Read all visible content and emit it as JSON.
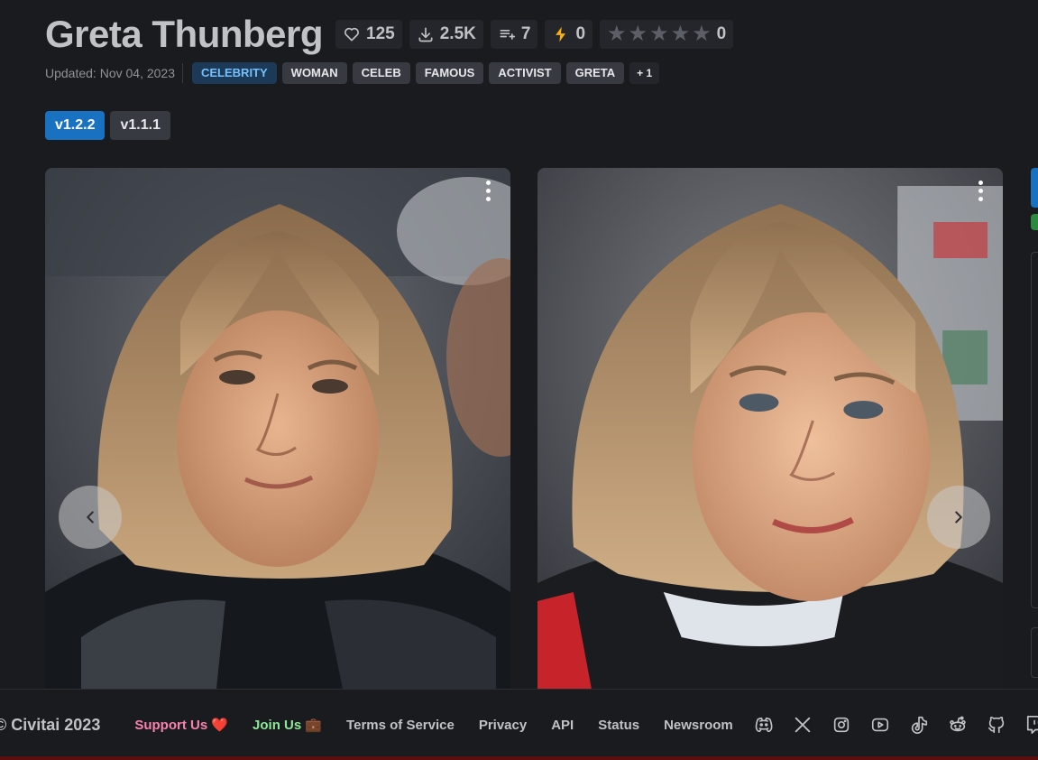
{
  "model": {
    "title": "Greta Thunberg",
    "stats": {
      "likes": "125",
      "downloads": "2.5K",
      "collections": "7",
      "buzz": "0",
      "rating_count": "0"
    },
    "updated": "Updated: Nov 04, 2023",
    "tags": [
      "CELEBRITY",
      "WOMAN",
      "CELEB",
      "FAMOUS",
      "ACTIVIST",
      "GRETA"
    ],
    "more_tags": "+ 1",
    "versions": [
      {
        "label": "v1.2.2",
        "active": true
      },
      {
        "label": "v1.1.1",
        "active": false
      }
    ]
  },
  "rating_stars": 5,
  "icons": {
    "likes": "heart-icon",
    "downloads": "download-icon",
    "collections": "playlist-add-icon",
    "buzz": "bolt-icon",
    "carousel_prev": "chevron-left-icon",
    "carousel_next": "chevron-right-icon",
    "image_menu": "dots-vertical-icon"
  },
  "footer": {
    "copyright": "© Civitai 2023",
    "links": {
      "support": "Support Us ❤️",
      "join": "Join Us 💼",
      "terms": "Terms of Service",
      "privacy": "Privacy",
      "api": "API",
      "status": "Status",
      "newsroom": "Newsroom"
    },
    "socials": [
      "discord-icon",
      "x-icon",
      "instagram-icon",
      "youtube-icon",
      "tiktok-icon",
      "reddit-icon",
      "github-icon",
      "twitch-icon"
    ]
  },
  "colors": {
    "background": "#1a1b1e",
    "accent": "#1971c2",
    "celebrity_tag": "#74c0fc",
    "buzz": "#fab005",
    "support": "#f783ac",
    "join": "#8ce99a"
  }
}
